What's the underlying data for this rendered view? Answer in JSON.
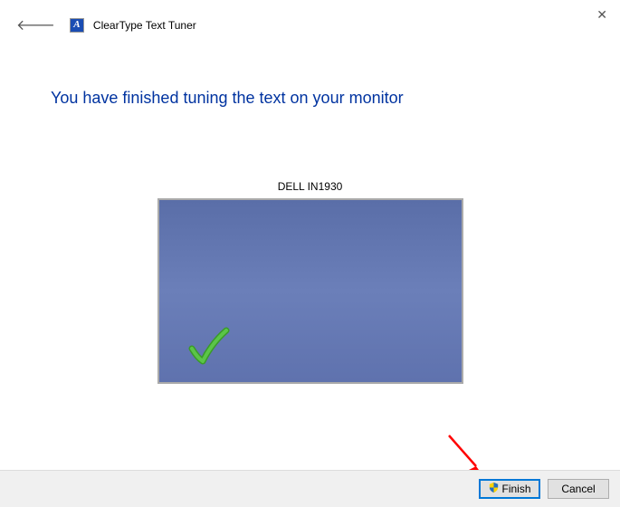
{
  "header": {
    "title": "ClearType Text Tuner",
    "app_icon_letter": "A"
  },
  "main": {
    "heading": "You have finished tuning the text on your monitor",
    "monitor_label": "DELL IN1930"
  },
  "footer": {
    "finish_label": "Finish",
    "cancel_label": "Cancel"
  }
}
